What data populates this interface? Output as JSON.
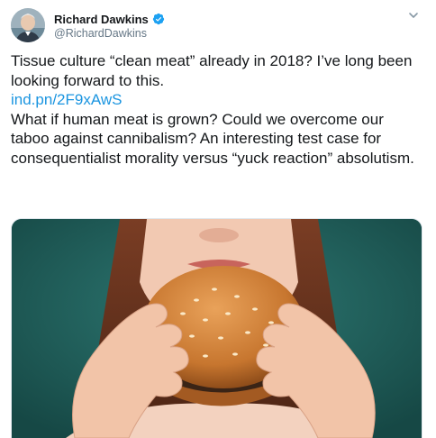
{
  "tweet": {
    "author": {
      "display_name": "Richard Dawkins",
      "handle": "@RichardDawkins",
      "verified": true,
      "verified_icon": "verified-badge-icon"
    },
    "menu_icon": "chevron-down-icon",
    "paragraph1": "Tissue culture “clean meat” already in 2018? I’ve long been looking forward to this.",
    "link_text": "ind.pn/2F9xAwS",
    "paragraph2": "What if human meat is grown? Could we overcome our taboo against cannibalism? An interesting test case for consequentialist morality versus “yuck reaction” absolutism.",
    "media": {
      "kind": "photo"
    },
    "colors": {
      "text": "#14171a",
      "secondary": "#657786",
      "link": "#1b95e0",
      "verified": "#1da1f2",
      "photo_background": "#1f5e5a"
    }
  }
}
